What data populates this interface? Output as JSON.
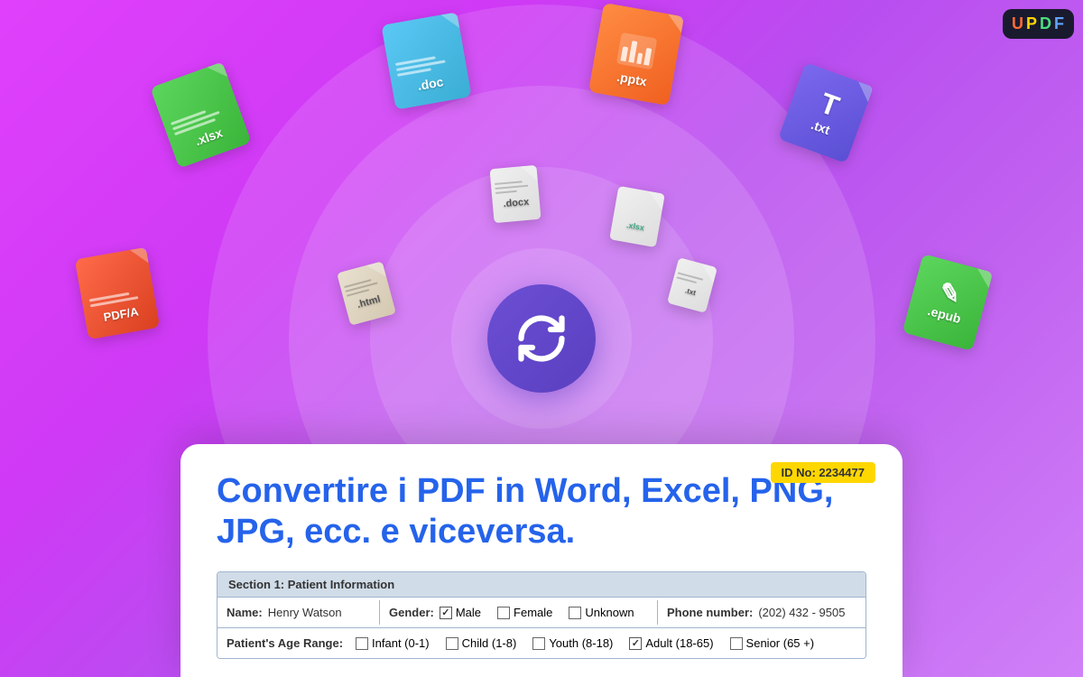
{
  "logo": {
    "letters": [
      {
        "char": "U",
        "color": "#ff6b35"
      },
      {
        "char": "P",
        "color": "#ffd700"
      },
      {
        "char": "D",
        "color": "#4ade80"
      },
      {
        "char": "F",
        "color": "#60a5fa"
      }
    ]
  },
  "file_icons": [
    {
      "id": "xlsx_large",
      "ext": ".xlsx",
      "color1": "#5cd65c",
      "color2": "#3ab53a",
      "size": "large"
    },
    {
      "id": "doc",
      "ext": ".doc",
      "color1": "#5bc8f5",
      "color2": "#3aaed4",
      "size": "large"
    },
    {
      "id": "pptx",
      "ext": ".pptx",
      "color1": "#ff8c42",
      "color2": "#f06020",
      "size": "large"
    },
    {
      "id": "txt",
      "ext": ".txt",
      "color1": "#7b68ee",
      "color2": "#5a4fd4",
      "size": "large"
    },
    {
      "id": "pdfa",
      "ext": "PDF/A",
      "color1": "#ff6b4a",
      "color2": "#d94020",
      "size": "large"
    },
    {
      "id": "epub",
      "ext": ".epub",
      "color1": "#5cd65c",
      "color2": "#3ab53a",
      "size": "large"
    },
    {
      "id": "html",
      "ext": ".html",
      "size": "small"
    },
    {
      "id": "docx_small",
      "ext": ".docx",
      "size": "small"
    },
    {
      "id": "xlsx_small",
      "ext": ".xlsx",
      "size": "small"
    },
    {
      "id": "txt_small",
      "ext": ".txt",
      "size": "small"
    }
  ],
  "id_badge": "ID No: 2234477",
  "main_title": "Convertire i PDF in Word, Excel, PNG, JPG, ecc. e viceversa.",
  "form": {
    "section_title": "Section 1: Patient Information",
    "rows": [
      {
        "cells": [
          {
            "label": "Name:",
            "value": "Henry Watson",
            "type": "text"
          },
          {
            "label": "Gender:",
            "type": "checkboxes",
            "options": [
              {
                "label": "Male",
                "checked": true
              },
              {
                "label": "Female",
                "checked": false
              },
              {
                "label": "Unknown",
                "checked": false
              }
            ]
          },
          {
            "label": "Phone number:",
            "value": "(202) 432 - 9505",
            "type": "text"
          }
        ]
      },
      {
        "cells": [
          {
            "label": "Patient's Age Range:",
            "type": "checkboxes",
            "options": [
              {
                "label": "Infant (0-1)",
                "checked": false
              },
              {
                "label": "Child (1-8)",
                "checked": false
              },
              {
                "label": "Youth (8-18)",
                "checked": false
              },
              {
                "label": "Adult (18-65)",
                "checked": true
              },
              {
                "label": "Senior (65 +)",
                "checked": false
              }
            ]
          }
        ]
      }
    ]
  }
}
